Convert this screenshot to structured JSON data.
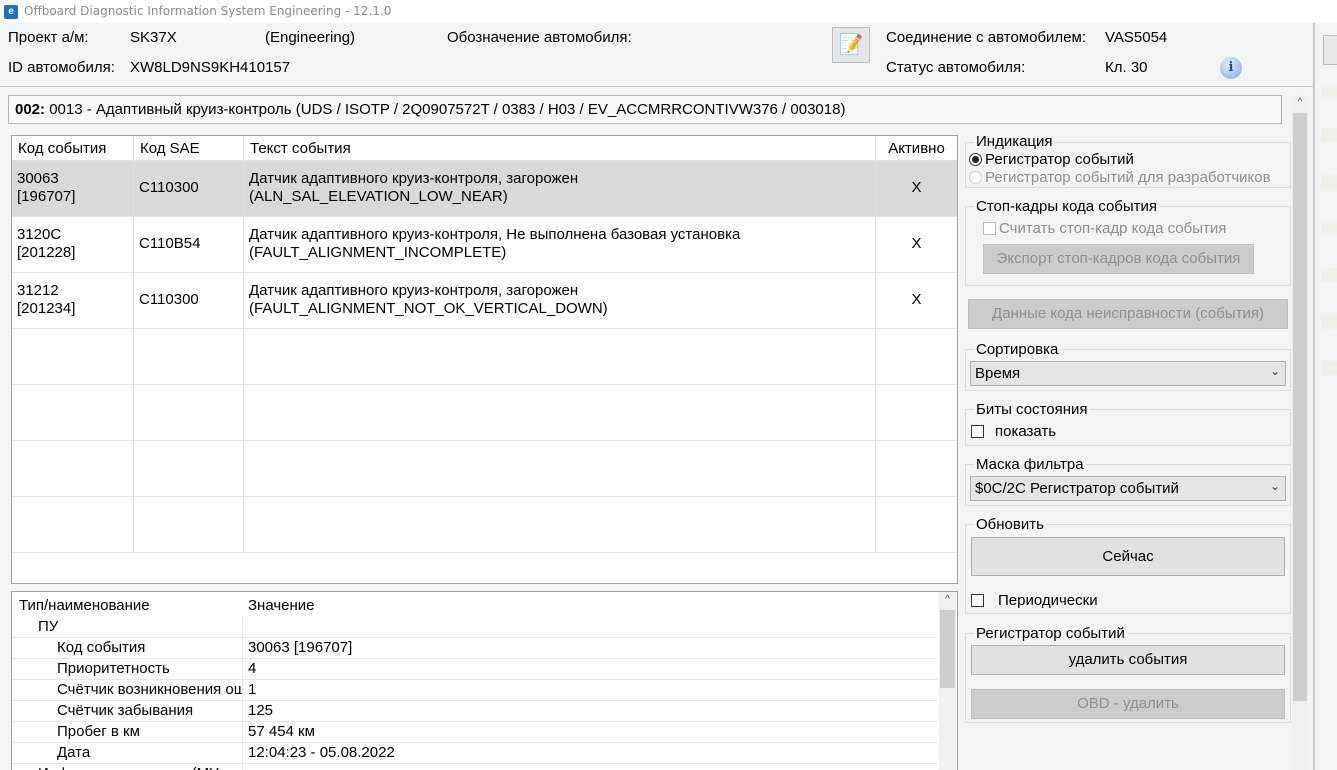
{
  "window": {
    "title": "Offboard Diagnostic Information System Engineering - 12.1.0",
    "icon": "odis-app-icon"
  },
  "header": {
    "project_label": "Проект а/м:",
    "project_value": "SK37X",
    "project_mode": "(Engineering)",
    "vin_label": "ID автомобиля:",
    "vin_value": "XW8LD9NS9KH410157",
    "designation_label": "Обозначение автомобиля:",
    "connection_label": "Соединение с автомобилем:",
    "connection_value": "VAS5054",
    "status_label": "Статус автомобиля:",
    "status_value": "Кл. 30",
    "info_icon_glyph": "i"
  },
  "module": {
    "prefix": "002:",
    "text": " 0013 - Адаптивный круиз-контроль  (UDS / ISOTP / 2Q0907572T / 0383 / H03 / EV_ACCMRRCONTIVW376 / 003018)"
  },
  "events": {
    "columns": [
      "Код события",
      "Код SAE",
      "Текст события",
      "Активно"
    ],
    "rows": [
      {
        "code": "30063",
        "code2": "[196707]",
        "sae": "C110300",
        "text1": "Датчик адаптивного круиз-контроля, загорожен",
        "text2": "(ALN_SAL_ELEVATION_LOW_NEAR)",
        "active": "X",
        "selected": true
      },
      {
        "code": "3120C",
        "code2": "[201228]",
        "sae": "C110B54",
        "text1": "Датчик адаптивного круиз-контроля, Не выполнена базовая установка",
        "text2": "(FAULT_ALIGNMENT_INCOMPLETE)",
        "active": "X",
        "selected": false
      },
      {
        "code": "31212",
        "code2": "[201234]",
        "sae": "C110300",
        "text1": "Датчик адаптивного круиз-контроля, загорожен",
        "text2": "(FAULT_ALIGNMENT_NOT_OK_VERTICAL_DOWN)",
        "active": "X",
        "selected": false
      }
    ]
  },
  "details": {
    "columns": [
      "Тип/наименование",
      "Значение"
    ],
    "group": "ПУ",
    "rows": [
      {
        "name": "Код события",
        "value": "30063 [196707]"
      },
      {
        "name": "Приоритетность",
        "value": "4"
      },
      {
        "name": "Счётчик возникновения ош",
        "value": "1"
      },
      {
        "name": "Счётчик забывания",
        "value": "125"
      },
      {
        "name": "Пробег в км",
        "value": "57 454 км"
      },
      {
        "name": "Дата",
        "value": "12:04:23 - 05.08.2022"
      }
    ],
    "cut_row": "Информация о среде (MY"
  },
  "panel": {
    "indication": {
      "title": "Индикация",
      "opt1": "Регистратор событий",
      "opt2": "Регистратор событий для разработчиков"
    },
    "freeze": {
      "title": "Стоп-кадры кода события",
      "checkbox": "Считать стоп-кадр кода события",
      "export": "Экспорт стоп-кадров кода события"
    },
    "fault_data": "Данные кода неисправности (события)",
    "sort": {
      "title": "Сортировка",
      "value": "Время"
    },
    "status_bits": {
      "title": "Биты состояния",
      "checkbox": "показать"
    },
    "filter": {
      "title": "Маска фильтра",
      "value": "$0C/2C Регистратор событий"
    },
    "refresh": {
      "title": "Обновить",
      "now": "Сейчас",
      "periodic": "Периодически"
    },
    "logger": {
      "title": "Регистратор событий",
      "delete": "удалить события",
      "obd_delete": "OBD - удалить"
    }
  }
}
